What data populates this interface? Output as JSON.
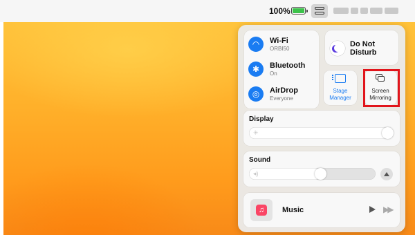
{
  "menubar": {
    "battery_percent": "100%",
    "battery_level": 1.0
  },
  "control_center": {
    "connectivity": [
      {
        "id": "wifi",
        "label": "Wi-Fi",
        "sub": "ORBI50",
        "icon": "wifi-icon",
        "glyph": "◠"
      },
      {
        "id": "bluetooth",
        "label": "Bluetooth",
        "sub": "On",
        "icon": "bluetooth-icon",
        "glyph": "✱"
      },
      {
        "id": "airdrop",
        "label": "AirDrop",
        "sub": "Everyone",
        "icon": "airdrop-icon",
        "glyph": "◎"
      }
    ],
    "do_not_disturb": {
      "label": "Do Not Disturb",
      "icon": "moon-icon"
    },
    "stage_manager": {
      "label": "Stage Manager",
      "icon": "stage-manager-icon"
    },
    "screen_mirroring": {
      "label": "Screen Mirroring",
      "icon": "screen-mirroring-icon"
    },
    "display": {
      "label": "Display",
      "level": 1.0,
      "icon": "brightness-icon",
      "glyph": "✳"
    },
    "sound": {
      "label": "Sound",
      "level": 0.5,
      "icon": "speaker-icon",
      "glyph": "◂)"
    },
    "music": {
      "label": "Music",
      "icon": "music-app-icon",
      "glyph": "♫"
    }
  },
  "colors": {
    "accent": "#1a7cf2",
    "highlight_box": "#e1141b",
    "battery": "#3cc24a",
    "music_app": "#fa4565",
    "wallpaper": "#ffb02a"
  }
}
